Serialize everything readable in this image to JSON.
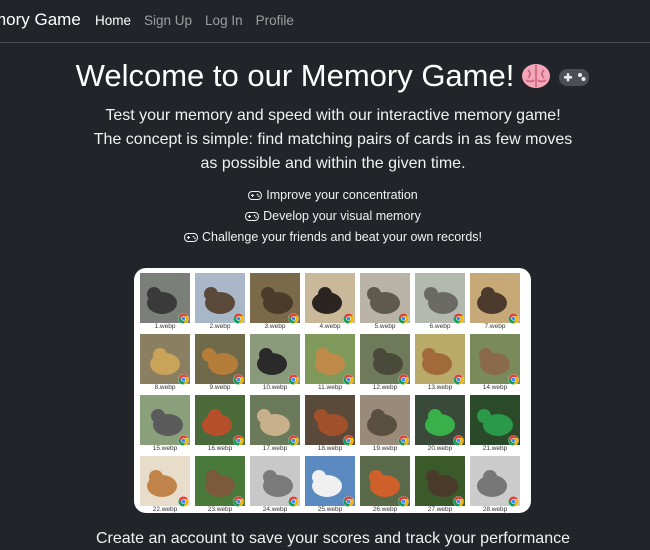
{
  "navbar": {
    "brand": "mory Game",
    "links": [
      {
        "label": "Home",
        "active": true
      },
      {
        "label": "Sign Up",
        "active": false
      },
      {
        "label": "Log In",
        "active": false
      },
      {
        "label": "Profile",
        "active": false
      }
    ]
  },
  "hero": {
    "title": "Welcome to our Memory Game!",
    "title_icons": [
      "brain-icon",
      "gamepad-icon"
    ],
    "lead": "Test your memory and speed with our interactive memory game! The concept is simple: find matching pairs of cards in as few moves as possible and within the given time.",
    "features": [
      "Improve your concentration",
      "Develop your visual memory",
      "Challenge your friends and beat your own records!"
    ]
  },
  "gallery": {
    "files": [
      {
        "name": "1.webp",
        "subject": "gorilla",
        "bg": "#7a7f7a",
        "fg": "#3a3a3a"
      },
      {
        "name": "2.webp",
        "subject": "wildebeest",
        "bg": "#a9b7c8",
        "fg": "#5b4a3a"
      },
      {
        "name": "3.webp",
        "subject": "warthog",
        "bg": "#7b6a4a",
        "fg": "#4a3b2b"
      },
      {
        "name": "4.webp",
        "subject": "chimpanzee",
        "bg": "#c9b99a",
        "fg": "#2b2420"
      },
      {
        "name": "5.webp",
        "subject": "crocodile",
        "bg": "#b8b3a5",
        "fg": "#5e5a4c"
      },
      {
        "name": "6.webp",
        "subject": "elephant",
        "bg": "#b4b9b0",
        "fg": "#6c6a64"
      },
      {
        "name": "7.webp",
        "subject": "warthog",
        "bg": "#c7a978",
        "fg": "#4c3a2c"
      },
      {
        "name": "8.webp",
        "subject": "leopard",
        "bg": "#8a7f60",
        "fg": "#c9a35a"
      },
      {
        "name": "9.webp",
        "subject": "lion",
        "bg": "#6e6a4a",
        "fg": "#b57d3a"
      },
      {
        "name": "10.webp",
        "subject": "gorilla",
        "bg": "#8a9a7a",
        "fg": "#2a2a2a"
      },
      {
        "name": "11.webp",
        "subject": "antelope",
        "bg": "#7f9a5a",
        "fg": "#c08a4a"
      },
      {
        "name": "12.webp",
        "subject": "crocodile",
        "bg": "#6e7a5a",
        "fg": "#4a4a3a"
      },
      {
        "name": "13.webp",
        "subject": "giraffe",
        "bg": "#b9aa6a",
        "fg": "#a06a3a"
      },
      {
        "name": "14.webp",
        "subject": "lizard",
        "bg": "#7a8a5a",
        "fg": "#8a6a4a"
      },
      {
        "name": "15.webp",
        "subject": "elephant",
        "bg": "#8aa07a",
        "fg": "#5a5a5a"
      },
      {
        "name": "16.webp",
        "subject": "red panda",
        "bg": "#4a6a3a",
        "fg": "#b5502a"
      },
      {
        "name": "17.webp",
        "subject": "monkey",
        "bg": "#6a7a5a",
        "fg": "#c8b08a"
      },
      {
        "name": "18.webp",
        "subject": "orangutan",
        "bg": "#5a4a3a",
        "fg": "#a0502a"
      },
      {
        "name": "19.webp",
        "subject": "crocodile",
        "bg": "#9a8a7a",
        "fg": "#5a5040"
      },
      {
        "name": "20.webp",
        "subject": "chameleon",
        "bg": "#3a4a3a",
        "fg": "#3ab04a"
      },
      {
        "name": "21.webp",
        "subject": "quetzal",
        "bg": "#2a4a2a",
        "fg": "#2a9a4a"
      },
      {
        "name": "22.webp",
        "subject": "caracal",
        "bg": "#e8dccb",
        "fg": "#c0844a"
      },
      {
        "name": "23.webp",
        "subject": "deer",
        "bg": "#4a7a3a",
        "fg": "#7a5a3a"
      },
      {
        "name": "24.webp",
        "subject": "wolf",
        "bg": "#c8c8c8",
        "fg": "#7a7a7a"
      },
      {
        "name": "25.webp",
        "subject": "polar bear",
        "bg": "#5a8ac0",
        "fg": "#f0f0f0"
      },
      {
        "name": "26.webp",
        "subject": "fox",
        "bg": "#5a6a4a",
        "fg": "#d0602a"
      },
      {
        "name": "27.webp",
        "subject": "moose",
        "bg": "#3a5a2a",
        "fg": "#4a3a2a"
      },
      {
        "name": "28.webp",
        "subject": "",
        "bg": "",
        "fg": ""
      }
    ]
  },
  "bottom": {
    "text": "Create an account to save your scores and track your performance"
  },
  "colors": {
    "background": "#212529",
    "panel": "#ffffff",
    "nav_inactive": "rgba(255,255,255,0.55)"
  }
}
